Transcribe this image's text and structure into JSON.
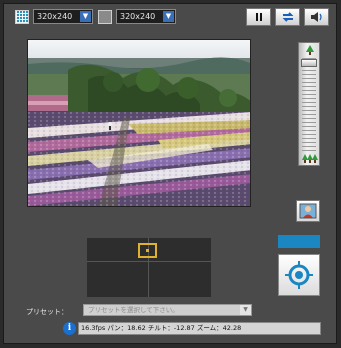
{
  "toolbar": {
    "resolution_left": "320x240",
    "resolution_right": "320x240",
    "pause_icon": "pause-icon",
    "refresh_icon": "refresh-icon",
    "audio_icon": "speaker-icon"
  },
  "zoom": {
    "tele_icon": "tree-small-icon",
    "wide_icon": "trees-wide-icon",
    "level": 0.05
  },
  "snapshot_icon": "snapshot-person-icon",
  "pan_tilt": {
    "position_marker": "position-marker"
  },
  "center_button_icon": "crosshair-icon",
  "preset": {
    "label": "プリセット：",
    "placeholder": "プリセットを選択して下さい。"
  },
  "status": {
    "text": "16.3fps パン：18.62 チルト：-12.87 ズーム：42.28"
  },
  "colors": {
    "accent_blue": "#1a86c2",
    "marker_orange": "#e0b030",
    "background": "#4a4a4a"
  }
}
